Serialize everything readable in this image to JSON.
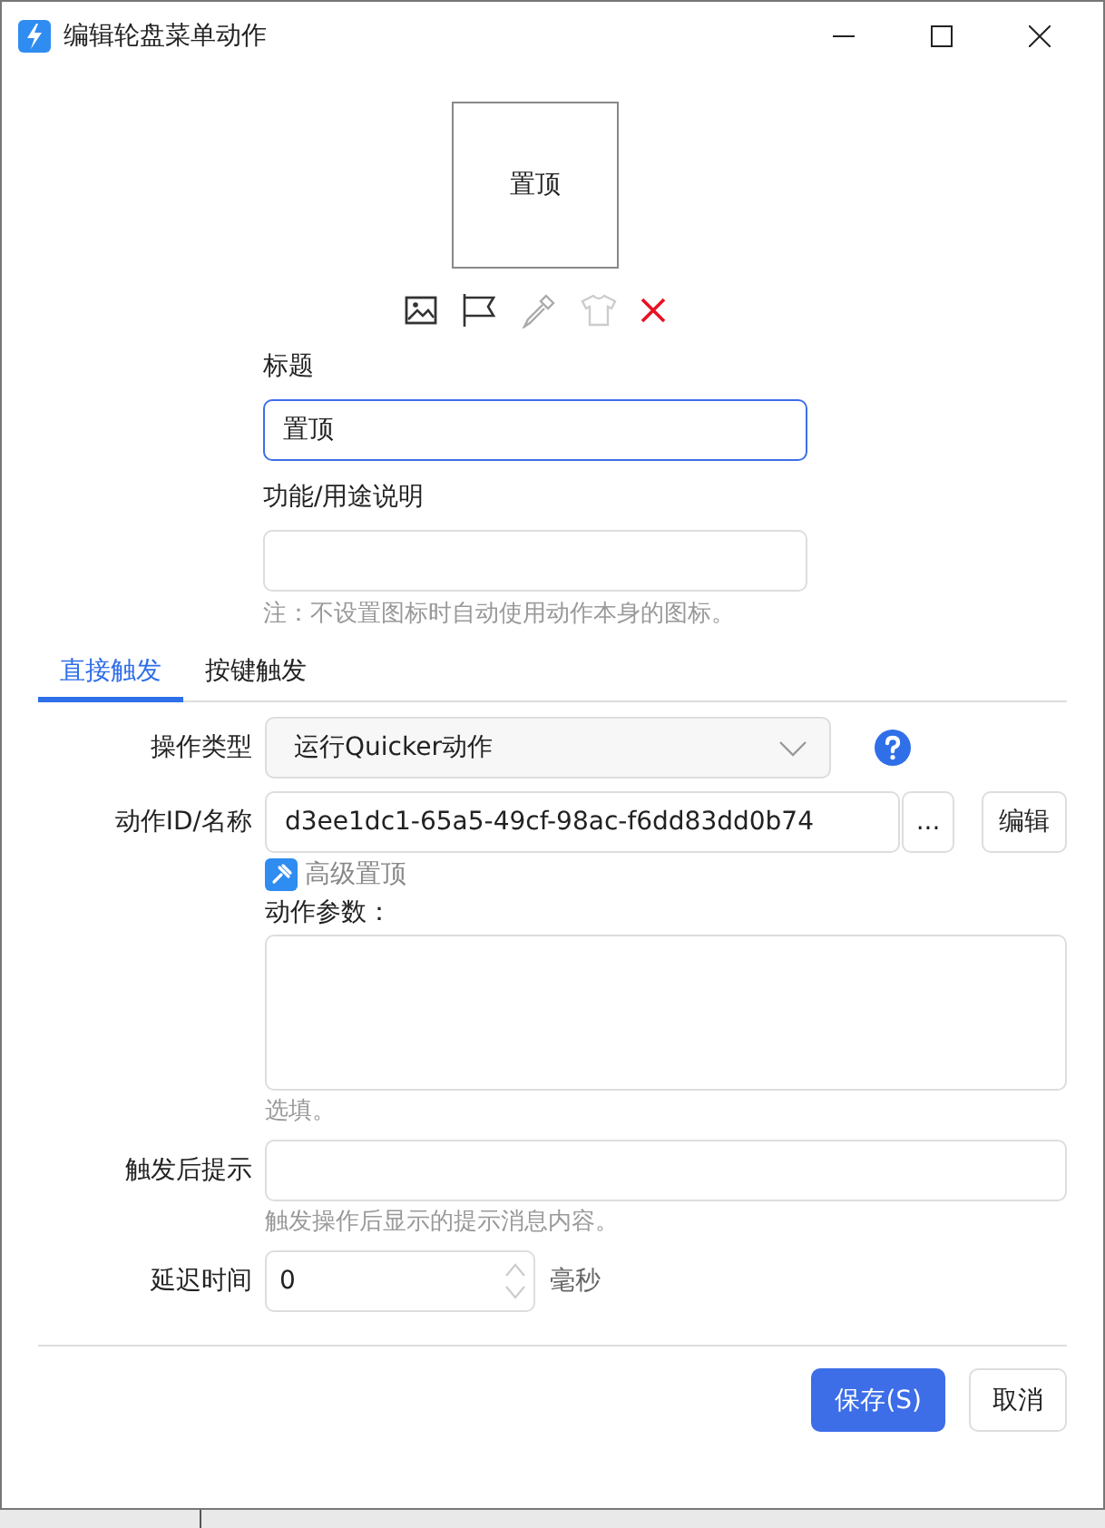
{
  "window": {
    "title": "编辑轮盘菜单动作"
  },
  "preview": {
    "label": "置顶"
  },
  "title_field": {
    "label": "标题",
    "value": "置顶",
    "focused": true
  },
  "description_field": {
    "label": "功能/用途说明",
    "note": "注：不设置图标时自动使用动作本身的图标。"
  },
  "tabs": [
    {
      "label": "直接触发",
      "selected": true
    },
    {
      "label": "按键触发",
      "selected": false
    }
  ],
  "operation_type": {
    "label": "操作类型",
    "value": "运行Quicker动作"
  },
  "action_id": {
    "label": "动作ID/名称",
    "value": "d3ee1dc1-65a5-49cf-98ac-f6dd83dd0b74",
    "browse": "...",
    "edit": "编辑"
  },
  "advanced_link": "高级置顶",
  "action_params": {
    "label": "动作参数：",
    "hint": "选填。"
  },
  "post_trigger_tip": {
    "label": "触发后提示",
    "hint": "触发操作后显示的提示消息内容。"
  },
  "delay": {
    "label": "延迟时间",
    "value": "0",
    "unit": "毫秒"
  },
  "buttons": [
    {
      "label": "保存(S)",
      "kind": "primary"
    },
    {
      "label": "取消",
      "kind": "default"
    }
  ]
}
